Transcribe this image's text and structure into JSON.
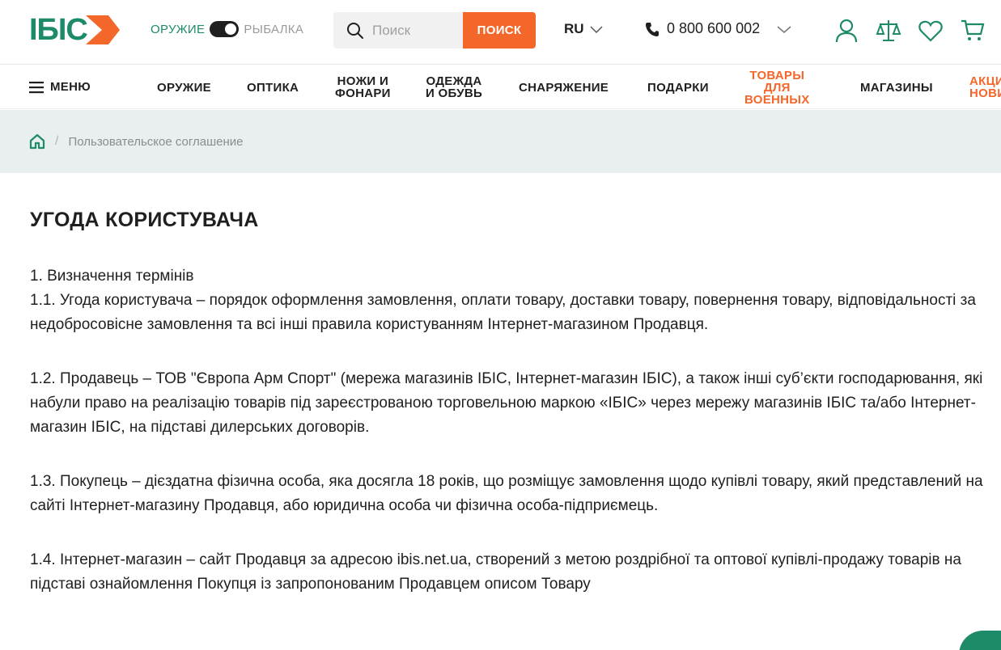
{
  "header": {
    "logo_text": "ІБІС",
    "toggle": {
      "left_label": "ОРУЖИЕ",
      "right_label": "РЫБАЛКА"
    },
    "search": {
      "placeholder": "Поиск",
      "button_label": "ПОИСК"
    },
    "language": "RU",
    "phone": "0 800 600 002",
    "icons": [
      "account-icon",
      "compare-scales-icon",
      "favorites-heart-icon",
      "cart-icon"
    ]
  },
  "nav": {
    "menu_label": "МЕНЮ",
    "items": [
      {
        "label": "ОРУЖИЕ",
        "highlight": false
      },
      {
        "label": "ОПТИКА",
        "highlight": false
      },
      {
        "label": "НОЖИ И\nФОНАРИ",
        "highlight": false
      },
      {
        "label": "ОДЕЖДА\nИ ОБУВЬ",
        "highlight": false
      },
      {
        "label": "СНАРЯЖЕНИЕ",
        "highlight": false
      },
      {
        "label": "ПОДАРКИ",
        "highlight": false
      },
      {
        "label": "ТОВАРЫ\nДЛЯ\nВОЕННЫХ",
        "highlight": true
      },
      {
        "label": "МАГАЗИНЫ",
        "highlight": false
      },
      {
        "label": "АКЦИ\nНОВИ",
        "highlight": true
      }
    ]
  },
  "breadcrumb": {
    "home_icon": "home-icon",
    "separator": "/",
    "current": "Пользовательское соглашение"
  },
  "content": {
    "title": "УГОДА КОРИСТУВАЧА",
    "section_heading": "1. Визначення термінів",
    "paragraphs": [
      "1.1. Угода користувача – порядок оформлення замовлення, оплати товару, доставки товару, повернення товару, відповідальності за недобросовісне замовлення та всі інші правила користуванням Інтернет-магазином Продавця.",
      "1.2. Продавець – ТОВ \"Європа Арм Спорт\" (мережа магазинів ІБІС, Інтернет-магазин ІБІС), а також інші суб’єкти господарювання, які набули право на реалізацію товарів під зареєстрованою торговельною маркою «ІБІС» через мережу магазинів ІБІС та/або Інтернет-магазин ІБІС, на підставі дилерських договорів.",
      "1.3. Покупець – дієздатна фізична особа, яка досягла 18 років, що розміщує замовлення щодо купівлі товару, який представлений на сайті Інтернет-магазину Продавця, або юридична особа чи фізична особа-підприємець.",
      "1.4. Інтернет-магазин – сайт Продавця за адресою ibis.net.ua, створений з метою роздрібної та оптової купівлі-продажу товарів на підставі ознайомлення Покупця із запропонованим Продавцем описом Товару"
    ]
  },
  "colors": {
    "brand_green": "#1d8a6a",
    "accent_orange": "#f4672a",
    "breadcrumb_bg": "#e9eeee"
  }
}
